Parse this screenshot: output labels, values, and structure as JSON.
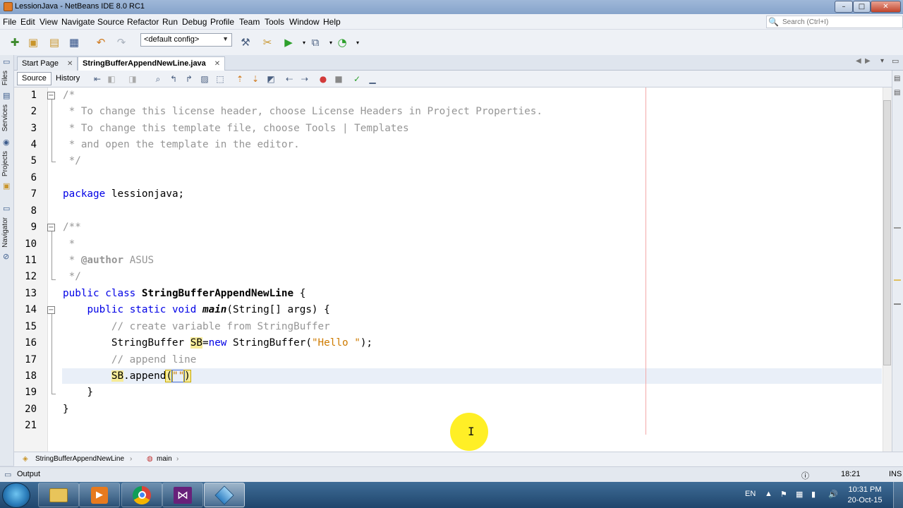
{
  "window": {
    "title": "LessionJava - NetBeans IDE 8.0 RC1"
  },
  "menu": [
    "File",
    "Edit",
    "View",
    "Navigate",
    "Source",
    "Refactor",
    "Run",
    "Debug",
    "Profile",
    "Team",
    "Tools",
    "Window",
    "Help"
  ],
  "search": {
    "placeholder": "Search (Ctrl+I)"
  },
  "toolbar": {
    "config_value": "<default config>"
  },
  "left_strip": {
    "files": "Files",
    "services": "Services",
    "projects": "Projects",
    "navigator": "Navigator"
  },
  "tabs": [
    {
      "label": "Start Page",
      "active": false
    },
    {
      "label": "StringBufferAppendNewLine.java",
      "active": true
    }
  ],
  "editor_modes": {
    "source": "Source",
    "history": "History"
  },
  "code": {
    "line_numbers": [
      "1",
      "2",
      "3",
      "4",
      "5",
      "6",
      "7",
      "8",
      "9",
      "10",
      "11",
      "12",
      "13",
      "14",
      "15",
      "16",
      "17",
      "18",
      "19",
      "20",
      "21"
    ],
    "l1": "/*",
    "l2": " * To change this license header, choose License Headers in Project Properties.",
    "l3": " * To change this template file, choose Tools | Templates",
    "l4": " * and open the template in the editor.",
    "l5": " */",
    "l7_kw": "package",
    "l7_rest": " lessionjava;",
    "l9": "/**",
    "l10": " *",
    "l11_a": " * ",
    "l11_tag": "@author",
    "l11_b": " ASUS",
    "l12": " */",
    "l13_kw": "public class",
    "l13_name": " StringBufferAppendNewLine",
    "l13_rest": " {",
    "l14_indent": "    ",
    "l14_kw": "public static void",
    "l14_sp": " ",
    "l14_name": "main",
    "l14_rest": "(String[] args) {",
    "l15": "        // create variable from StringBuffer",
    "l16_a": "        StringBuffer ",
    "l16_var": "SB",
    "l16_eq": "=",
    "l16_kw": "new",
    "l16_b": " StringBuffer(",
    "l16_str": "\"Hello \"",
    "l16_c": ");",
    "l17": "        // append line",
    "l18_indent": "        ",
    "l18_var": "SB",
    "l18_a": ".append",
    "l18_p1": "(",
    "l18_str": "\"\"",
    "l18_p2": ")",
    "l19": "    }",
    "l20": "}"
  },
  "breadcrumb": {
    "class_name": "StringBufferAppendNewLine",
    "method": "main"
  },
  "status": {
    "output": "Output",
    "position": "18:21",
    "mode": "INS"
  },
  "taskbar": {
    "language": "EN",
    "time": "10:31 PM",
    "date": "20-Oct-15"
  }
}
